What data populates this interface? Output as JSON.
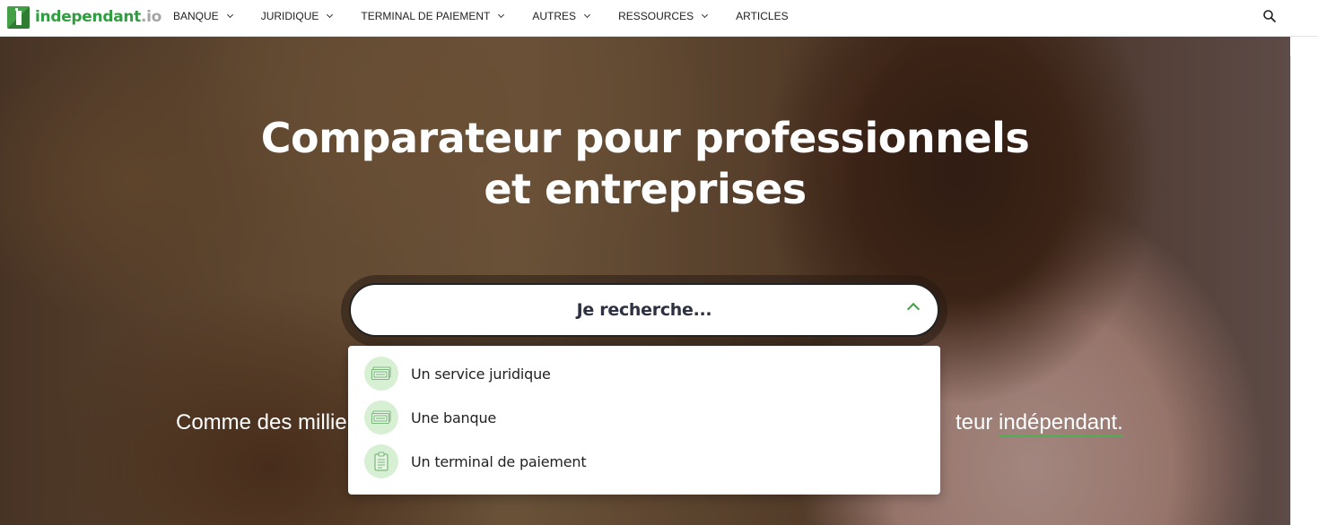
{
  "brand": {
    "name": "independant",
    "tld": ".io"
  },
  "nav": {
    "items": [
      {
        "label": "BANQUE",
        "has_dropdown": true
      },
      {
        "label": "JURIDIQUE",
        "has_dropdown": true
      },
      {
        "label": "TERMINAL DE PAIEMENT",
        "has_dropdown": true
      },
      {
        "label": "AUTRES",
        "has_dropdown": true
      },
      {
        "label": "RESSOURCES",
        "has_dropdown": true
      },
      {
        "label": "ARTICLES",
        "has_dropdown": false
      }
    ],
    "search_icon": "search-icon",
    "admin_icon": "wordpress-icon"
  },
  "hero": {
    "title": "Comparateur pour professionnels et entreprises",
    "tagline_left": "Comme des millie",
    "tagline_right_prefix": "teur ",
    "tagline_accent": "indépendant."
  },
  "search": {
    "label": "Je recherche...",
    "expanded": true,
    "options": [
      {
        "label": "Un service juridique",
        "icon": "cash-icon"
      },
      {
        "label": "Une banque",
        "icon": "cash-icon"
      },
      {
        "label": "Un terminal de paiement",
        "icon": "clipboard-icon"
      }
    ]
  },
  "colors": {
    "brand_green": "#2e9e3e",
    "accent_green": "#43a047",
    "icon_bg": "#d7f0d3"
  }
}
